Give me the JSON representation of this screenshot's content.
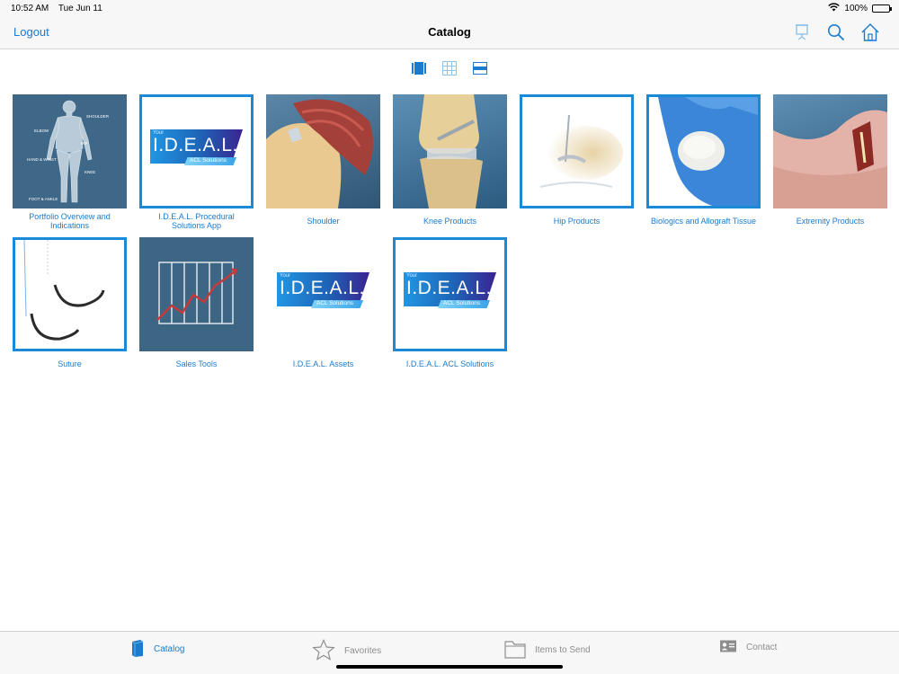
{
  "status": {
    "time": "10:52 AM",
    "date": "Tue Jun 11",
    "battery": "100%"
  },
  "nav": {
    "left_label": "Logout",
    "title": "Catalog"
  },
  "tiles": [
    {
      "label": "Portfolio Overview and Indications"
    },
    {
      "label": "I.D.E.A.L. Procedural Solutions App"
    },
    {
      "label": "Shoulder"
    },
    {
      "label": "Knee Products"
    },
    {
      "label": "Hip Products"
    },
    {
      "label": "Biologics and Allograft Tissue"
    },
    {
      "label": "Extremity Products"
    },
    {
      "label": "Suture"
    },
    {
      "label": "Sales Tools"
    },
    {
      "label": "I.D.E.A.L. Assets"
    },
    {
      "label": "I.D.E.A.L. ACL Solutions"
    }
  ],
  "body_map_labels": {
    "shoulder": "SHOULDER",
    "elbow": "ELBOW",
    "hip": "HIP",
    "hand": "HAND & WRIST",
    "knee": "KNEE",
    "foot": "FOOT & ANKLE"
  },
  "ideal_logo": {
    "your": "Your",
    "name": "I.D.E.A.L.",
    "sub": "ACL Solutions"
  },
  "tabs": [
    {
      "label": "Catalog"
    },
    {
      "label": "Favorites"
    },
    {
      "label": "Items to Send"
    },
    {
      "label": "Contact"
    }
  ],
  "colors": {
    "accent": "#1a7bd0",
    "tile_frame": "#1a8ad8",
    "slate": "#3e6788"
  }
}
